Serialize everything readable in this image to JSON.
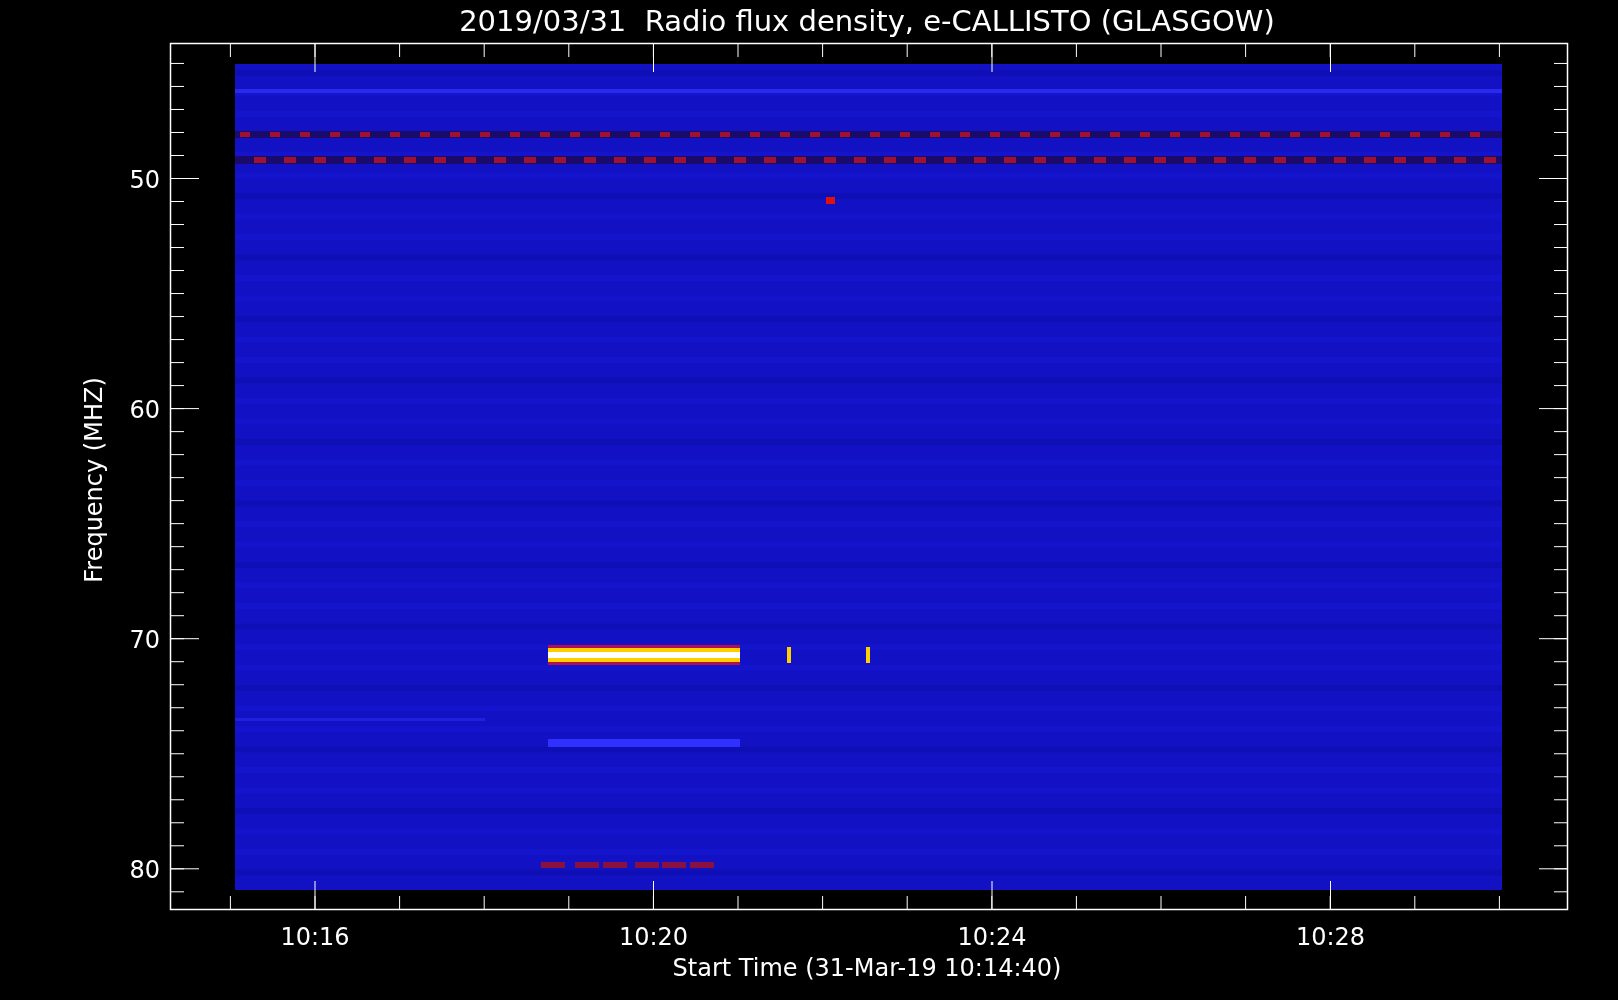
{
  "title": "2019/03/31  Radio flux density, e-CALLISTO (GLASGOW)",
  "y_axis": {
    "label": "Frequency (MHZ)",
    "ticks": [
      "50",
      "60",
      "70",
      "80"
    ]
  },
  "x_axis": {
    "label": "Start Time (31-Mar-19 10:14:40)",
    "ticks": [
      "10:16",
      "10:20",
      "10:24",
      "10:28"
    ]
  }
}
